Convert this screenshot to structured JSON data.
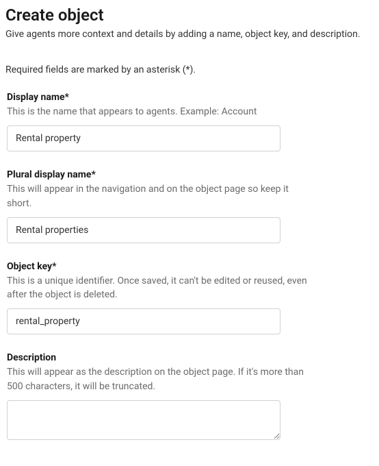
{
  "header": {
    "title": "Create object",
    "subtitle": "Give agents more context and details by adding a name, object key, and description."
  },
  "requiredNote": "Required fields are marked by an asterisk (*).",
  "fields": {
    "displayName": {
      "label": "Display name*",
      "help": "This is the name that appears to agents. Example: Account",
      "value": "Rental property"
    },
    "pluralDisplayName": {
      "label": "Plural display name*",
      "help": "This will appear in the navigation and on the object page so keep it short.",
      "value": "Rental properties"
    },
    "objectKey": {
      "label": "Object key*",
      "help": "This is a unique identifier. Once saved, it can't be edited or reused, even after the object is deleted.",
      "value": "rental_property"
    },
    "description": {
      "label": "Description",
      "help": "This will appear as the description on the object page. If it's more than 500 characters, it will be truncated.",
      "value": ""
    }
  }
}
